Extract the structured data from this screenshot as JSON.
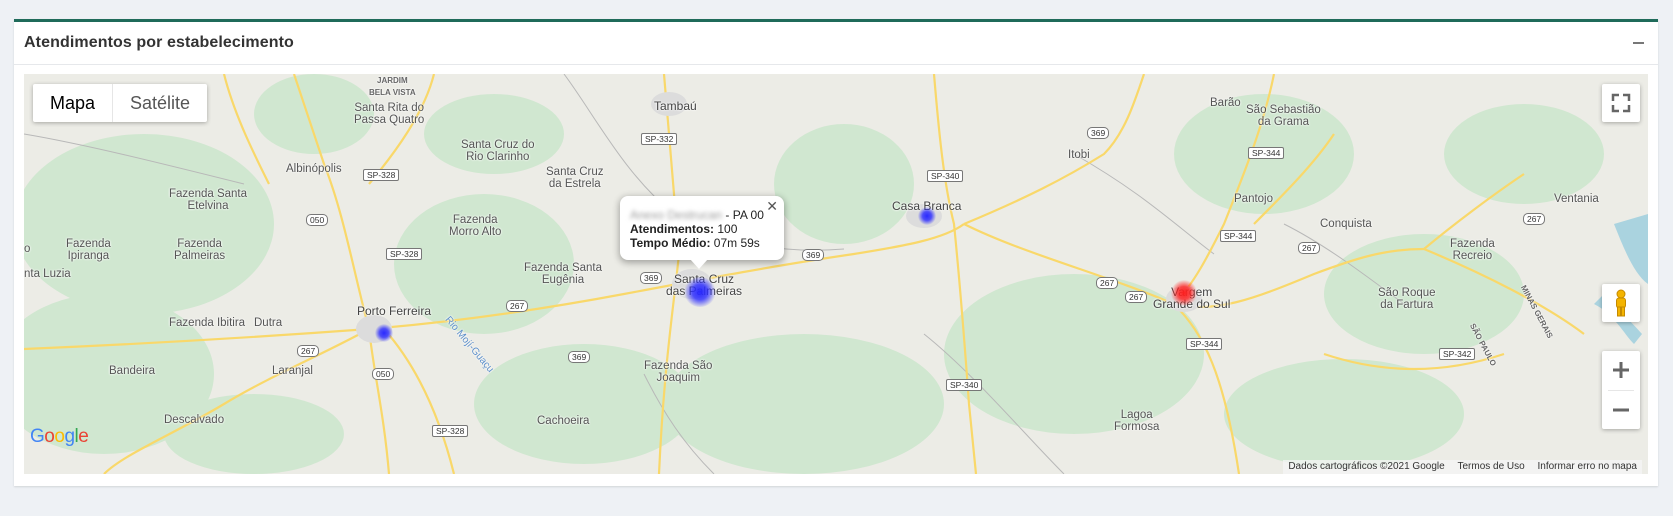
{
  "panel": {
    "title": "Atendimentos por estabelecimento"
  },
  "map": {
    "type_buttons": [
      "Mapa",
      "Satélite"
    ],
    "active_type": "Mapa",
    "places": [
      "JARDIM\nBELA VISTA",
      "Tambaú",
      "Santa Rita do\nPassa Quatro",
      "Santa Cruz do\nRio Clarinho",
      "Albinópolis",
      "Santa Cruz\nda Estrela",
      "Fazenda Santa\nEtelvina",
      "Fazenda\nMorro Alto",
      "Fazenda\nIpiranga",
      "Fazenda\nPalmeiras",
      "nta Luzia",
      "Fazenda Santa\nEugênia",
      "Santa Cruz\ndas Palmeiras",
      "Porto Ferreira",
      "Fazenda Ibitira",
      "Dutra",
      "Laranjal",
      "Bandeira",
      "Descalvado",
      "Fazenda São\nJoaquim",
      "Cachoeira",
      "Casa Branca",
      "Itobi",
      "Barão",
      "São Sebastião\nda Grama",
      "Pantojo",
      "Conquista",
      "Ventania",
      "Fazenda\nRecreio",
      "Vargem\nGrande do Sul",
      "São Roque\nda Fartura",
      "Lagoa\nFormosa",
      "o",
      "Rio Mojí-Guaçu",
      "SÃO PAULO",
      "MINAS GERAIS"
    ],
    "shields": [
      "SP-332",
      "SP-328",
      "050",
      "SP-328",
      "267",
      "369",
      "369",
      "369",
      "267",
      "050",
      "SP-328",
      "SP-340",
      "369",
      "SP-340",
      "SP-344",
      "SP-344",
      "267",
      "267",
      "267",
      "SP-344",
      "SP-342",
      "267"
    ],
    "heat_colors": {
      "low": "#2a2aff",
      "high": "#ff2020"
    },
    "infowindow": {
      "name_blurred": "Anexo Destrucan",
      "suffix": "- PA 00",
      "atendimentos_label": "Atendimentos:",
      "atendimentos_value": "100",
      "tempo_label": "Tempo Médio:",
      "tempo_value": "07m 59s",
      "close": "✕"
    },
    "logo": "Google",
    "attribution": [
      "Dados cartográficos ©2021 Google",
      "Termos de Uso",
      "Informar erro no mapa"
    ]
  }
}
